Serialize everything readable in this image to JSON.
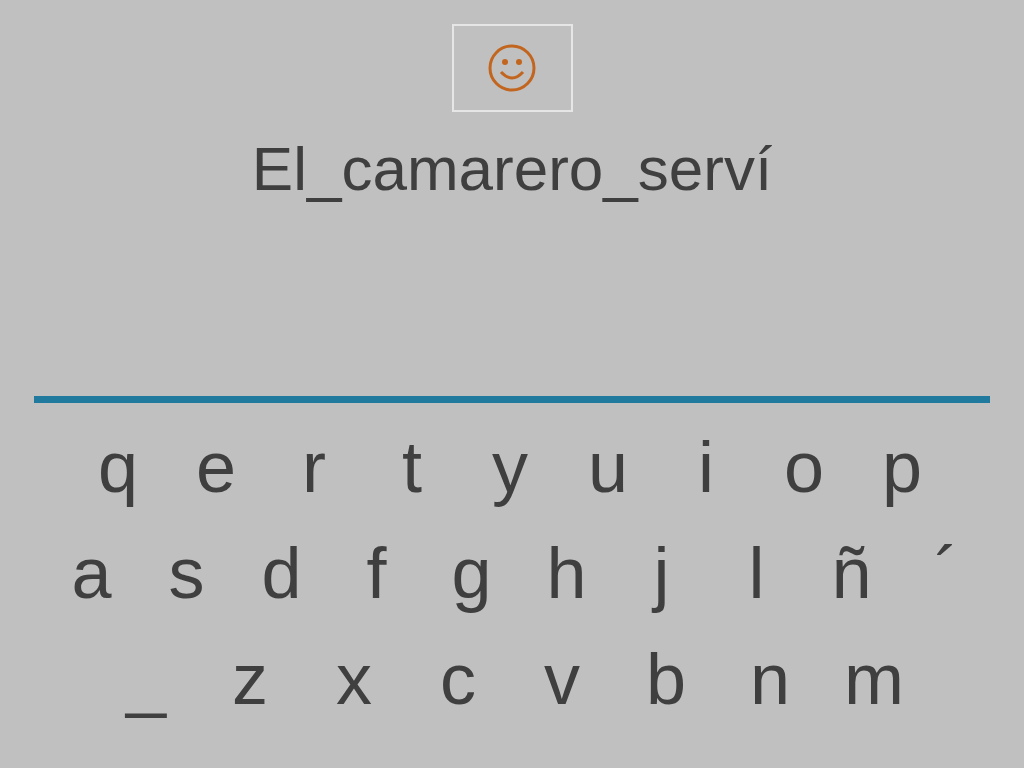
{
  "phrase": "El_camarero_serví",
  "keyboard": {
    "rows": [
      [
        "q",
        "e",
        "r",
        "t",
        "y",
        "u",
        "i",
        "o",
        "p"
      ],
      [
        "a",
        "s",
        "d",
        "f",
        "g",
        "h",
        "j",
        "l",
        "ñ",
        "´"
      ],
      [
        "_",
        "z",
        "x",
        "c",
        "v",
        "b",
        "n",
        "m"
      ]
    ]
  }
}
